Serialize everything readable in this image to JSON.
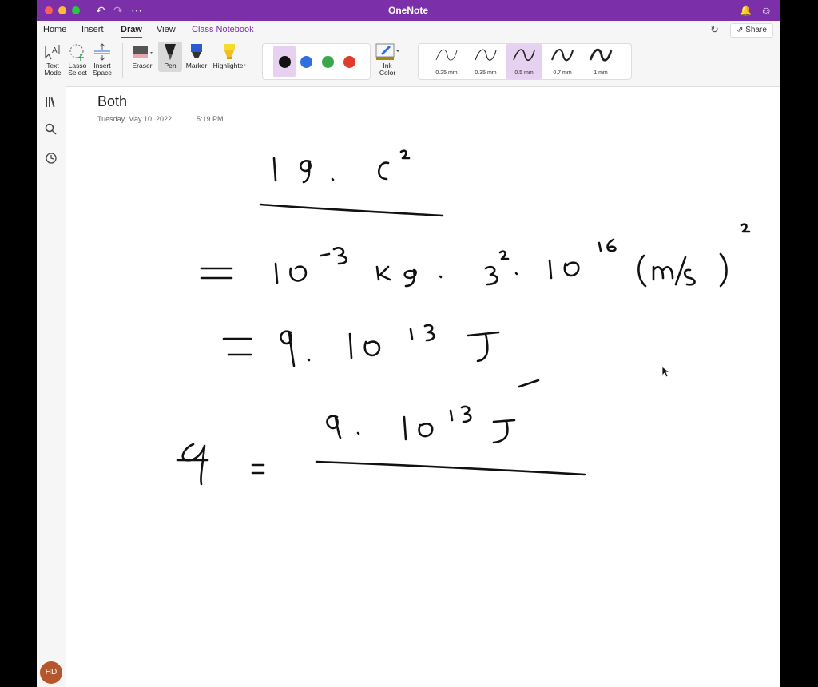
{
  "window": {
    "title": "OneNote"
  },
  "tabs": [
    "Home",
    "Insert",
    "Draw",
    "View",
    "Class Notebook"
  ],
  "active_tab": "Draw",
  "share": {
    "label": "Share"
  },
  "tools": {
    "text_mode": {
      "line1": "Text",
      "line2": "Mode"
    },
    "lasso_select": {
      "line1": "Lasso",
      "line2": "Select"
    },
    "insert_space": {
      "line1": "Insert",
      "line2": "Space"
    },
    "eraser": "Eraser",
    "pen": "Pen",
    "marker": "Marker",
    "highlighter": "Highlighter",
    "ink_color": {
      "line1": "Ink",
      "line2": "Color"
    }
  },
  "ink_colors": [
    "#111111",
    "#2f6fe0",
    "#3aa84a",
    "#e23b2e"
  ],
  "selected_color_index": 0,
  "widths": [
    "0.25 mm",
    "0.35 mm",
    "0.5 mm",
    "0.7 mm",
    "1 mm"
  ],
  "selected_width_index": 2,
  "page": {
    "title": "Both",
    "date": "Tuesday, May 10, 2022",
    "time": "5:19 PM"
  },
  "user": {
    "initials": "HD"
  },
  "colors": {
    "accent": "#7b2fa8",
    "avatar": "#b5562c"
  }
}
